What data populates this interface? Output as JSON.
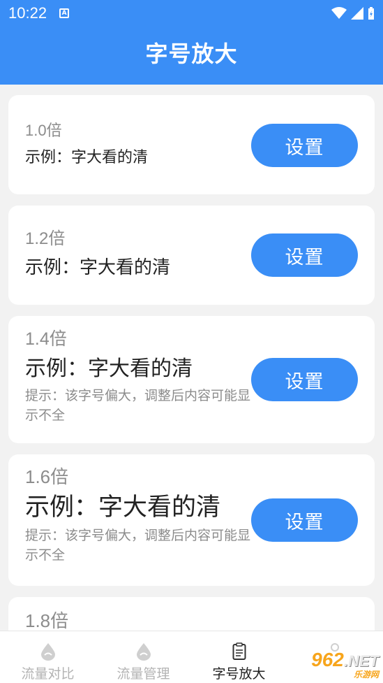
{
  "status_bar": {
    "time": "10:22",
    "notification_icon": "A"
  },
  "header": {
    "title": "字号放大"
  },
  "cards": [
    {
      "multiplier": "1.0倍",
      "example": "示例：字大看的清",
      "tip": "",
      "button": "设置"
    },
    {
      "multiplier": "1.2倍",
      "example": "示例：字大看的清",
      "tip": "",
      "button": "设置"
    },
    {
      "multiplier": "1.4倍",
      "example": "示例：字大看的清",
      "tip": "提示：该字号偏大，调整后内容可能显示不全",
      "button": "设置"
    },
    {
      "multiplier": "1.6倍",
      "example": "示例：字大看的清",
      "tip": "提示：该字号偏大，调整后内容可能显示不全",
      "button": "设置"
    },
    {
      "multiplier": "1.8倍",
      "example": "",
      "tip": "",
      "button": ""
    }
  ],
  "bottom_nav": {
    "items": [
      {
        "label": "流量对比",
        "icon": "drop-icon",
        "active": false
      },
      {
        "label": "流量管理",
        "icon": "drop-icon",
        "active": false
      },
      {
        "label": "字号放大",
        "icon": "clipboard-icon",
        "active": true
      },
      {
        "label": "",
        "icon": "settings-icon",
        "active": false
      }
    ]
  },
  "watermark": {
    "main": "962",
    "suffix": ".NET",
    "sub": "乐游网"
  },
  "colors": {
    "primary": "#3a8ef6",
    "background": "#f2f2f2",
    "muted": "#8c8c8c"
  }
}
